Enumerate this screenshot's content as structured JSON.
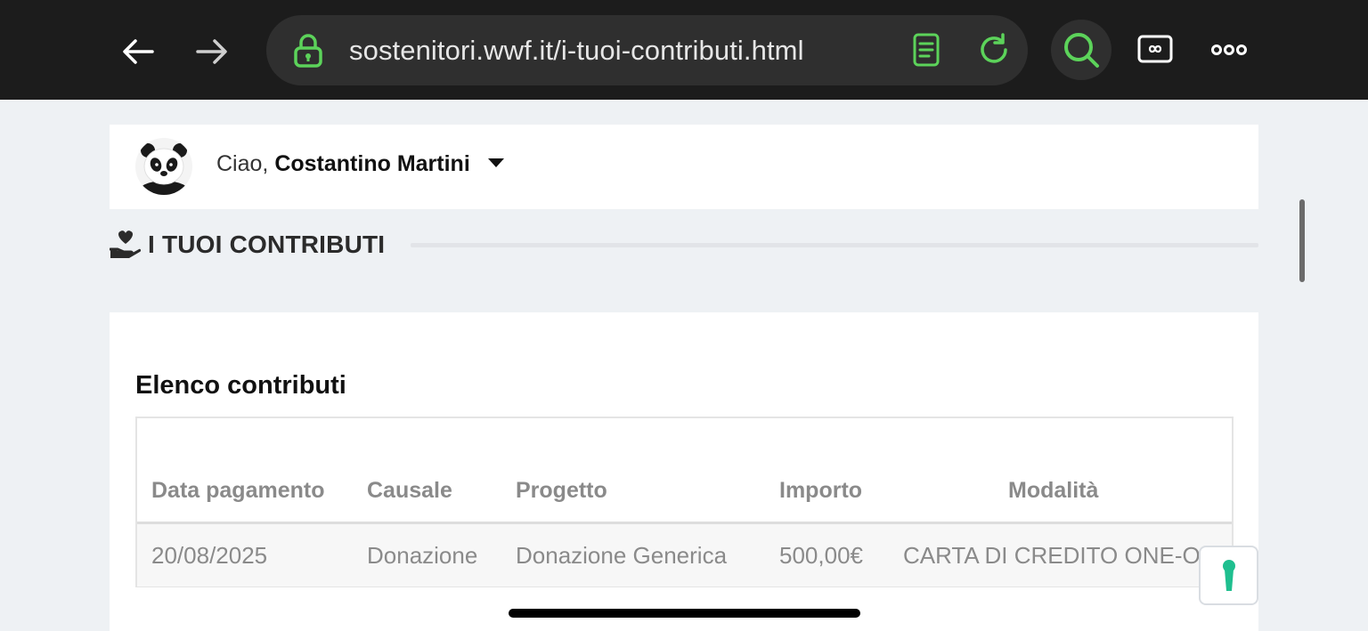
{
  "browser": {
    "url": "sostenitori.wwf.it/i-tuoi-contributi.html",
    "accent": "#5cd35a",
    "icons": [
      "back-arrow-icon",
      "forward-arrow-icon",
      "lock-icon",
      "reader-icon",
      "reload-icon",
      "search-icon",
      "tabs-icon",
      "more-icon"
    ]
  },
  "user": {
    "greeting": "Ciao,",
    "name": "Costantino Martini"
  },
  "section": {
    "title": "I TUOI CONTRIBUTI"
  },
  "contributions": {
    "title": "Elenco contributi",
    "columns": [
      "Data pagamento",
      "Causale",
      "Progetto",
      "Importo",
      "Modalità"
    ],
    "rows": [
      [
        "20/08/2025",
        "Donazione",
        "Donazione Generica",
        "500,00€",
        "CARTA DI CREDITO ONE-OFF"
      ]
    ]
  },
  "floating_button": {
    "icon": "keyhole-icon",
    "color": "#1fbf8f"
  }
}
